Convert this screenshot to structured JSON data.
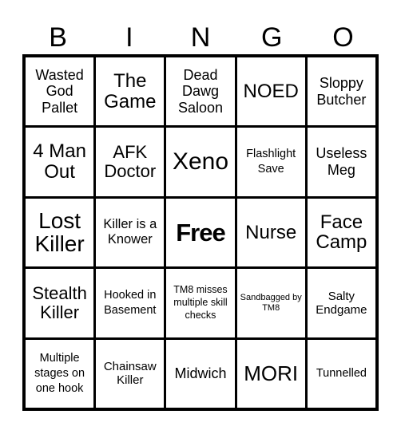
{
  "header": {
    "letters": [
      "B",
      "I",
      "N",
      "G",
      "O"
    ]
  },
  "board": {
    "rows": [
      [
        "Wasted God Pallet",
        "The Game",
        "Dead Dawg Saloon",
        "NOED",
        "Sloppy Butcher"
      ],
      [
        "4 Man Out",
        "AFK Doctor",
        "Xeno",
        "Flashlight Save",
        "Useless Meg"
      ],
      [
        "Lost Killer",
        "Killer is a Knower",
        "Free",
        "Nurse",
        "Face Camp"
      ],
      [
        "Stealth Killer",
        "Hooked in Basement",
        "TM8 misses multiple skill checks",
        "Sandbagged by TM8",
        "Salty Endgame"
      ],
      [
        "Multiple stages on one hook",
        "Chainsaw Killer",
        "Midwich",
        "MORI",
        "Tunnelled"
      ]
    ]
  },
  "colors": {
    "grid_line": "#000000",
    "cell_background": "#ffffff",
    "text": "#000000"
  }
}
